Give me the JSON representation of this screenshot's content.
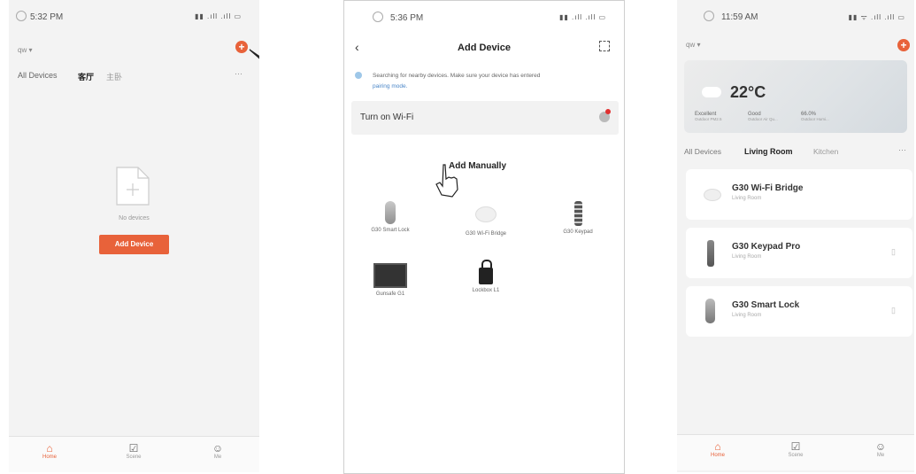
{
  "screen1": {
    "status_time": "5:32 PM",
    "status_right": "▮▮ .ıll .ıll ▭",
    "home_name": "qw ▾",
    "tabs": [
      "All Devices",
      "客厅",
      "主卧"
    ],
    "more": "···",
    "empty_text": "No devices",
    "add_device_button": "Add Device",
    "bottom_tabs": [
      "Home",
      "Scene",
      "Me"
    ]
  },
  "screen2": {
    "status_time": "5:36 PM",
    "status_right": "▮▮ .ıll .ıll ▭",
    "title": "Add Device",
    "search_text": "Searching for nearby devices. Make sure your device has entered",
    "search_link": "pairing mode.",
    "wifi_label": "Turn on Wi-Fi",
    "manual_title": "Add Manually",
    "devices": [
      "G30 Smart Lock",
      "G30 Wi-Fi Bridge",
      "G30 Keypad",
      "Gunsafe G1",
      "Lockbox L1"
    ]
  },
  "screen3": {
    "status_time": "11:59 AM",
    "status_right": "▮▮ ᯤ .ıll .ıll ▭",
    "home_name": "qw ▾",
    "temperature": "22°C",
    "weather_items": [
      {
        "value": "Excellent",
        "label": "Outdoor PM2.5"
      },
      {
        "value": "Good",
        "label": "Outdoor Air Qu..."
      },
      {
        "value": "66.0%",
        "label": "Outdoor Humi..."
      }
    ],
    "tabs": [
      "All Devices",
      "Living Room",
      "Kitchen"
    ],
    "more": "···",
    "devices": [
      {
        "name": "G30 Wi-Fi Bridge",
        "room": "Living Room"
      },
      {
        "name": "G30 Keypad Pro",
        "room": "Living Room"
      },
      {
        "name": "G30 Smart Lock",
        "room": "Living Room"
      }
    ],
    "bottom_tabs": [
      "Home",
      "Scene",
      "Me"
    ]
  },
  "colors": {
    "accent": "#e8623a",
    "bg": "#f3f3f3"
  }
}
